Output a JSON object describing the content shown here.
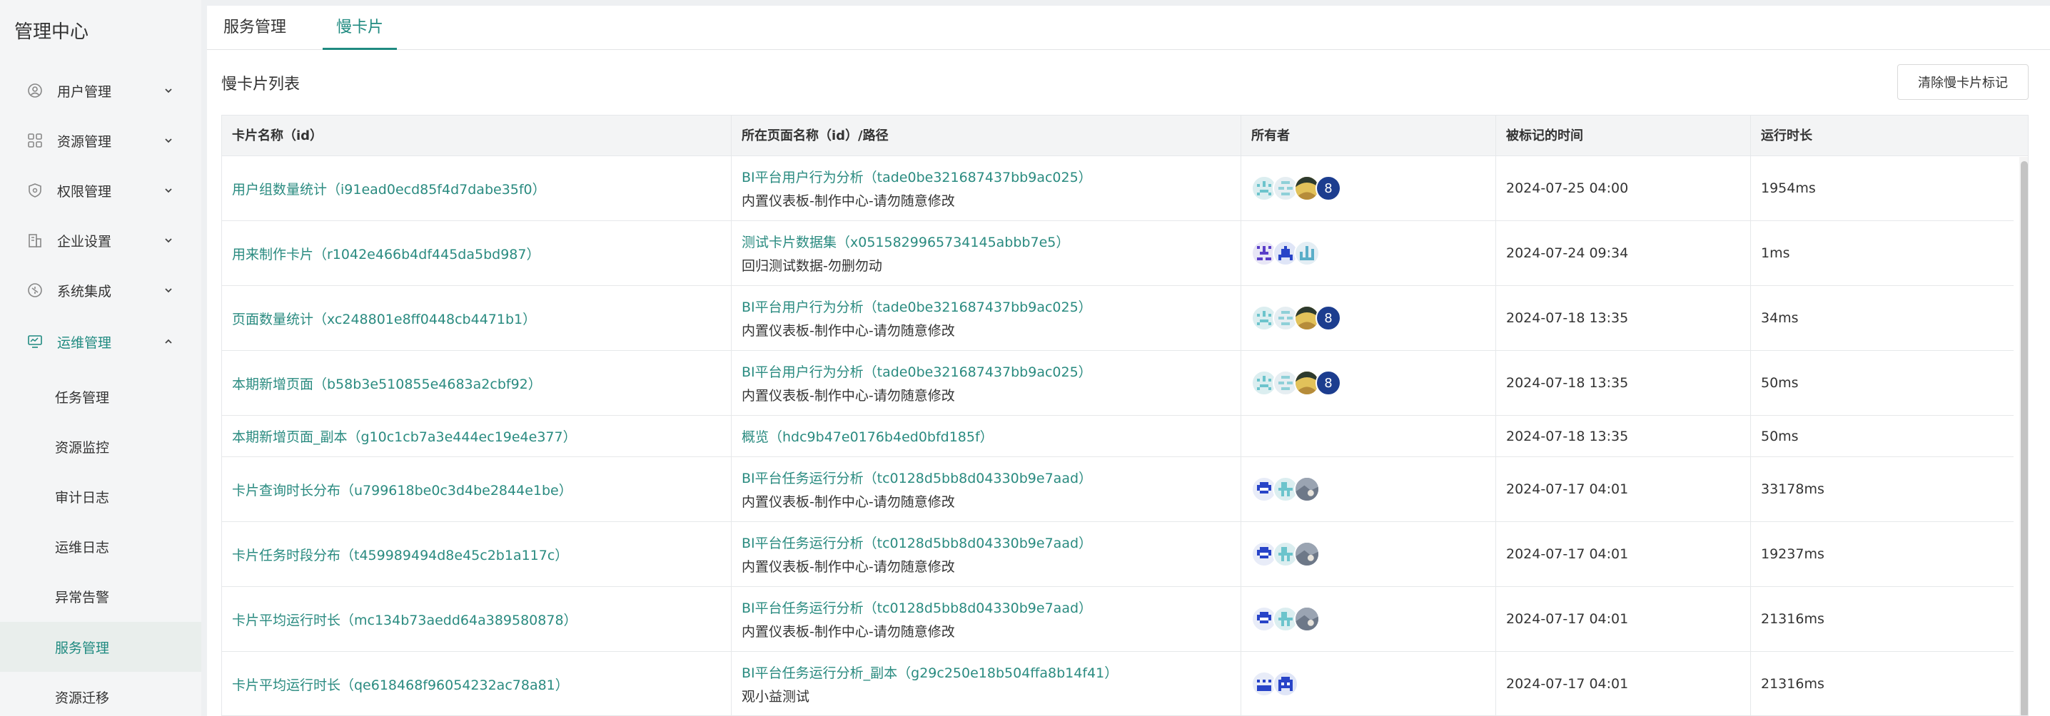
{
  "app": {
    "title": "管理中心"
  },
  "sidebar": {
    "items": [
      {
        "label": "用户管理",
        "icon": "user-icon",
        "expanded": false
      },
      {
        "label": "资源管理",
        "icon": "grid-icon",
        "expanded": false
      },
      {
        "label": "权限管理",
        "icon": "shield-icon",
        "expanded": false
      },
      {
        "label": "企业设置",
        "icon": "building-icon",
        "expanded": false
      },
      {
        "label": "系统集成",
        "icon": "integration-icon",
        "expanded": false
      },
      {
        "label": "运维管理",
        "icon": "monitor-icon",
        "expanded": true
      }
    ],
    "subitems": [
      {
        "label": "任务管理"
      },
      {
        "label": "资源监控"
      },
      {
        "label": "审计日志"
      },
      {
        "label": "运维日志"
      },
      {
        "label": "异常告警"
      },
      {
        "label": "服务管理",
        "selected": true
      },
      {
        "label": "资源迁移"
      }
    ]
  },
  "tabs": [
    {
      "label": "服务管理",
      "active": false
    },
    {
      "label": "慢卡片",
      "active": true
    }
  ],
  "section": {
    "title": "慢卡片列表",
    "clear_button": "清除慢卡片标记"
  },
  "table": {
    "columns": [
      "卡片名称（id）",
      "所在页面名称（id）/路径",
      "所有者",
      "被标记的时间",
      "运行时长"
    ],
    "rows": [
      {
        "card": "用户组数量统计（i91ead0ecd85f4d7dabe35f0）",
        "page": "BI平台用户行为分析（tade0be321687437bb9ac025）",
        "path": "内置仪表板-制作中心-请勿随意修改",
        "owners": [
          "owner-a",
          "owner-b",
          "owner-c",
          "8"
        ],
        "time": "2024-07-25 04:00",
        "duration": "1954ms"
      },
      {
        "card": "用来制作卡片（r1042e466b4df445da5bd987）",
        "page": "测试卡片数据集（x0515829965734145abbb7e5）",
        "path": "回归测试数据-勿删勿动",
        "owners": [
          "owner-d",
          "owner-e",
          "owner-f"
        ],
        "time": "2024-07-24 09:34",
        "duration": "1ms"
      },
      {
        "card": "页面数量统计（xc248801e8ff0448cb4471b1）",
        "page": "BI平台用户行为分析（tade0be321687437bb9ac025）",
        "path": "内置仪表板-制作中心-请勿随意修改",
        "owners": [
          "owner-a",
          "owner-b",
          "owner-c",
          "8"
        ],
        "time": "2024-07-18 13:35",
        "duration": "34ms"
      },
      {
        "card": "本期新增页面（b58b3e510855e4683a2cbf92）",
        "page": "BI平台用户行为分析（tade0be321687437bb9ac025）",
        "path": "内置仪表板-制作中心-请勿随意修改",
        "owners": [
          "owner-a",
          "owner-b",
          "owner-c",
          "8"
        ],
        "time": "2024-07-18 13:35",
        "duration": "50ms"
      },
      {
        "card": "本期新增页面_副本（g10c1cb7a3e444ec19e4e377）",
        "page": "概览（hdc9b47e0176b4ed0bfd185f）",
        "path": "",
        "owners": [],
        "time": "2024-07-18 13:35",
        "duration": "50ms"
      },
      {
        "card": "卡片查询时长分布（u799618be0c3d4be2844e1be）",
        "page": "BI平台任务运行分析（tc0128d5bb8d04330b9e7aad）",
        "path": "内置仪表板-制作中心-请勿随意修改",
        "owners": [
          "owner-g",
          "owner-h",
          "owner-i"
        ],
        "time": "2024-07-17 04:01",
        "duration": "33178ms"
      },
      {
        "card": "卡片任务时段分布（t459989494d8e45c2b1a117c）",
        "page": "BI平台任务运行分析（tc0128d5bb8d04330b9e7aad）",
        "path": "内置仪表板-制作中心-请勿随意修改",
        "owners": [
          "owner-g",
          "owner-h",
          "owner-i"
        ],
        "time": "2024-07-17 04:01",
        "duration": "19237ms"
      },
      {
        "card": "卡片平均运行时长（mc134b73aedd64a389580878）",
        "page": "BI平台任务运行分析（tc0128d5bb8d04330b9e7aad）",
        "path": "内置仪表板-制作中心-请勿随意修改",
        "owners": [
          "owner-g",
          "owner-h",
          "owner-i"
        ],
        "time": "2024-07-17 04:01",
        "duration": "21316ms"
      },
      {
        "card": "卡片平均运行时长（qe618468f96054232ac78a81）",
        "page": "BI平台任务运行分析_副本（g29c250e18b504ffa8b14f41）",
        "path": "观小益测试",
        "owners": [
          "owner-j",
          "owner-k"
        ],
        "time": "2024-07-17 04:01",
        "duration": "21316ms"
      }
    ]
  },
  "colors": {
    "accent": "#1f8a80",
    "link": "#2a8b80",
    "avatar_badge": "#1c3d8f"
  }
}
